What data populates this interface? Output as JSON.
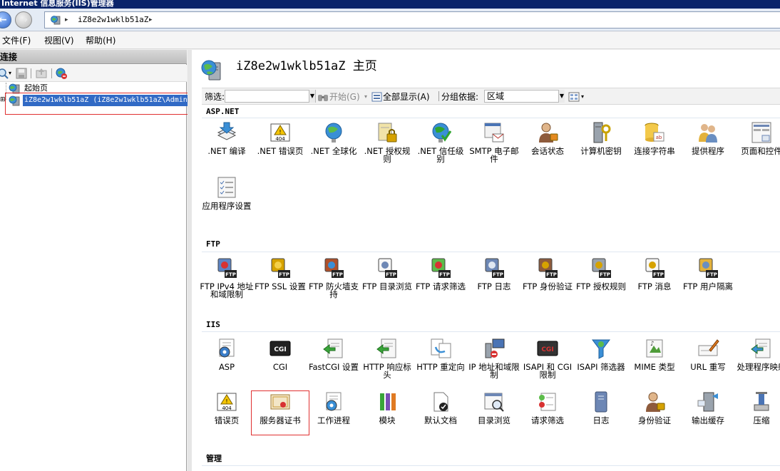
{
  "window": {
    "title": "Internet 信息服务(IIS)管理器"
  },
  "address": {
    "path": "iZ8e2w1wklb51aZ",
    "sep": "▸"
  },
  "menu": {
    "file": "文件(F)",
    "view": "视图(V)",
    "help": "帮助(H)"
  },
  "connections": {
    "header": "连接",
    "tree": [
      {
        "label": "起始页"
      },
      {
        "label": "iZ8e2w1wklb51aZ (iZ8e2w1wklb51aZ\\Admin"
      }
    ]
  },
  "main": {
    "title": "iZ8e2w1wklb51aZ 主页",
    "filter": {
      "label": "筛选:",
      "value": "",
      "start": "开始(G)",
      "show_all": "全部显示(A)",
      "group_by_label": "分组依据:",
      "group_by_value": "区域"
    },
    "groups": [
      {
        "name": "ASP.NET",
        "items": [
          {
            "label": ".NET 编译",
            "icon": "net-compile-icon"
          },
          {
            "label": ".NET 错误页",
            "icon": "net-error-pages-icon"
          },
          {
            "label": ".NET 全球化",
            "icon": "net-globalization-icon"
          },
          {
            "label": ".NET 授权规则",
            "icon": "net-authorization-icon"
          },
          {
            "label": ".NET 信任级别",
            "icon": "net-trust-icon"
          },
          {
            "label": "SMTP 电子邮件",
            "icon": "smtp-email-icon"
          },
          {
            "label": "会话状态",
            "icon": "session-state-icon"
          },
          {
            "label": "计算机密钥",
            "icon": "machine-key-icon"
          },
          {
            "label": "连接字符串",
            "icon": "connection-strings-icon"
          },
          {
            "label": "提供程序",
            "icon": "providers-icon"
          },
          {
            "label": "页面和控件",
            "icon": "pages-controls-icon"
          },
          {
            "label": "应用程序设置",
            "icon": "app-settings-icon"
          }
        ]
      },
      {
        "name": "FTP",
        "items": [
          {
            "label": "FTP IPv4 地址和域限制",
            "icon": "ftp-ipv4-icon"
          },
          {
            "label": "FTP SSL 设置",
            "icon": "ftp-ssl-icon"
          },
          {
            "label": "FTP 防火墙支持",
            "icon": "ftp-firewall-icon"
          },
          {
            "label": "FTP 目录浏览",
            "icon": "ftp-directory-browsing-icon"
          },
          {
            "label": "FTP 请求筛选",
            "icon": "ftp-request-filtering-icon"
          },
          {
            "label": "FTP 日志",
            "icon": "ftp-logging-icon"
          },
          {
            "label": "FTP 身份验证",
            "icon": "ftp-authentication-icon"
          },
          {
            "label": "FTP 授权规则",
            "icon": "ftp-authorization-icon"
          },
          {
            "label": "FTP 消息",
            "icon": "ftp-messages-icon"
          },
          {
            "label": "FTP 用户隔离",
            "icon": "ftp-user-isolation-icon"
          }
        ]
      },
      {
        "name": "IIS",
        "items": [
          {
            "label": "ASP",
            "icon": "asp-icon"
          },
          {
            "label": "CGI",
            "icon": "cgi-icon"
          },
          {
            "label": "FastCGI 设置",
            "icon": "fastcgi-icon"
          },
          {
            "label": "HTTP 响应标头",
            "icon": "http-response-headers-icon"
          },
          {
            "label": "HTTP 重定向",
            "icon": "http-redirect-icon"
          },
          {
            "label": "IP 地址和域限制",
            "icon": "ip-restrictions-icon"
          },
          {
            "label": "ISAPI 和 CGI 限制",
            "icon": "isapi-cgi-restrictions-icon"
          },
          {
            "label": "ISAPI 筛选器",
            "icon": "isapi-filters-icon"
          },
          {
            "label": "MIME 类型",
            "icon": "mime-types-icon"
          },
          {
            "label": "URL 重写",
            "icon": "url-rewrite-icon"
          },
          {
            "label": "处理程序映射",
            "icon": "handler-mappings-icon"
          },
          {
            "label": "错误页",
            "icon": "error-pages-icon"
          },
          {
            "label": "服务器证书",
            "icon": "server-certificates-icon"
          },
          {
            "label": "工作进程",
            "icon": "worker-processes-icon"
          },
          {
            "label": "模块",
            "icon": "modules-icon"
          },
          {
            "label": "默认文档",
            "icon": "default-document-icon"
          },
          {
            "label": "目录浏览",
            "icon": "directory-browsing-icon"
          },
          {
            "label": "请求筛选",
            "icon": "request-filtering-icon"
          },
          {
            "label": "日志",
            "icon": "logging-icon"
          },
          {
            "label": "身份验证",
            "icon": "authentication-icon"
          },
          {
            "label": "输出缓存",
            "icon": "output-caching-icon"
          },
          {
            "label": "压缩",
            "icon": "compression-icon"
          }
        ]
      },
      {
        "name": "管理",
        "items": []
      }
    ]
  },
  "colors": {
    "title_bar": "#0a246a",
    "selection": "#316ac5",
    "highlight_box": "#e03030",
    "group_rule": "#dfe7f1"
  }
}
